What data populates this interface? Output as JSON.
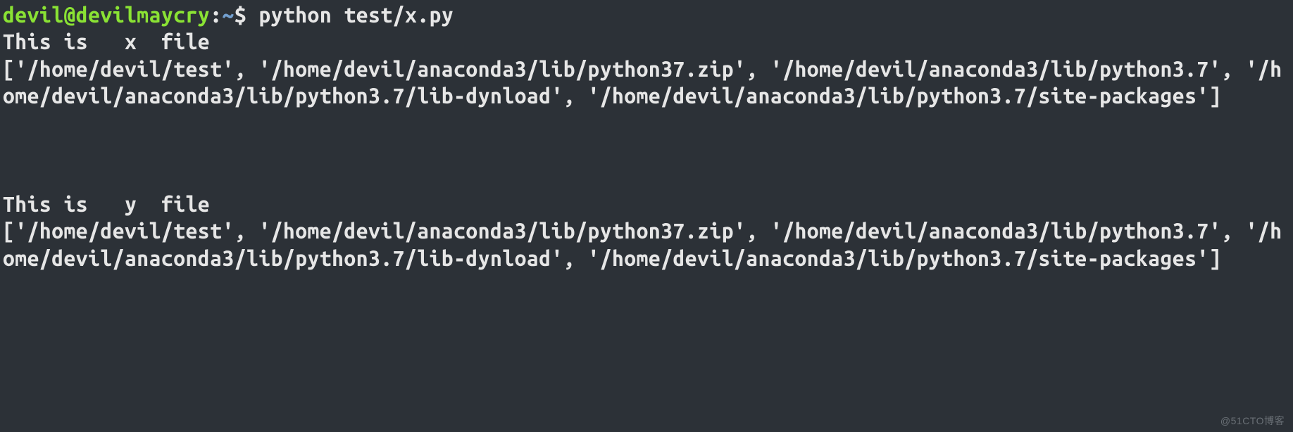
{
  "prompt": {
    "user": "devil@devilmaycry",
    "colon": ":",
    "path": "~",
    "dollar": "$ "
  },
  "command": "python test/x.py",
  "output": {
    "line1": "This is   x  file",
    "line2": "['/home/devil/test', '/home/devil/anaconda3/lib/python37.zip', '/home/devil/anaconda3/lib/python3.7', '/home/devil/anaconda3/lib/python3.7/lib-dynload', '/home/devil/anaconda3/lib/python3.7/site-packages']",
    "line3": "",
    "line4": "",
    "line5": "",
    "line6": "This is   y  file",
    "line7": "['/home/devil/test', '/home/devil/anaconda3/lib/python37.zip', '/home/devil/anaconda3/lib/python3.7', '/home/devil/anaconda3/lib/python3.7/lib-dynload', '/home/devil/anaconda3/lib/python3.7/site-packages']"
  },
  "watermark": "@51CTO博客"
}
